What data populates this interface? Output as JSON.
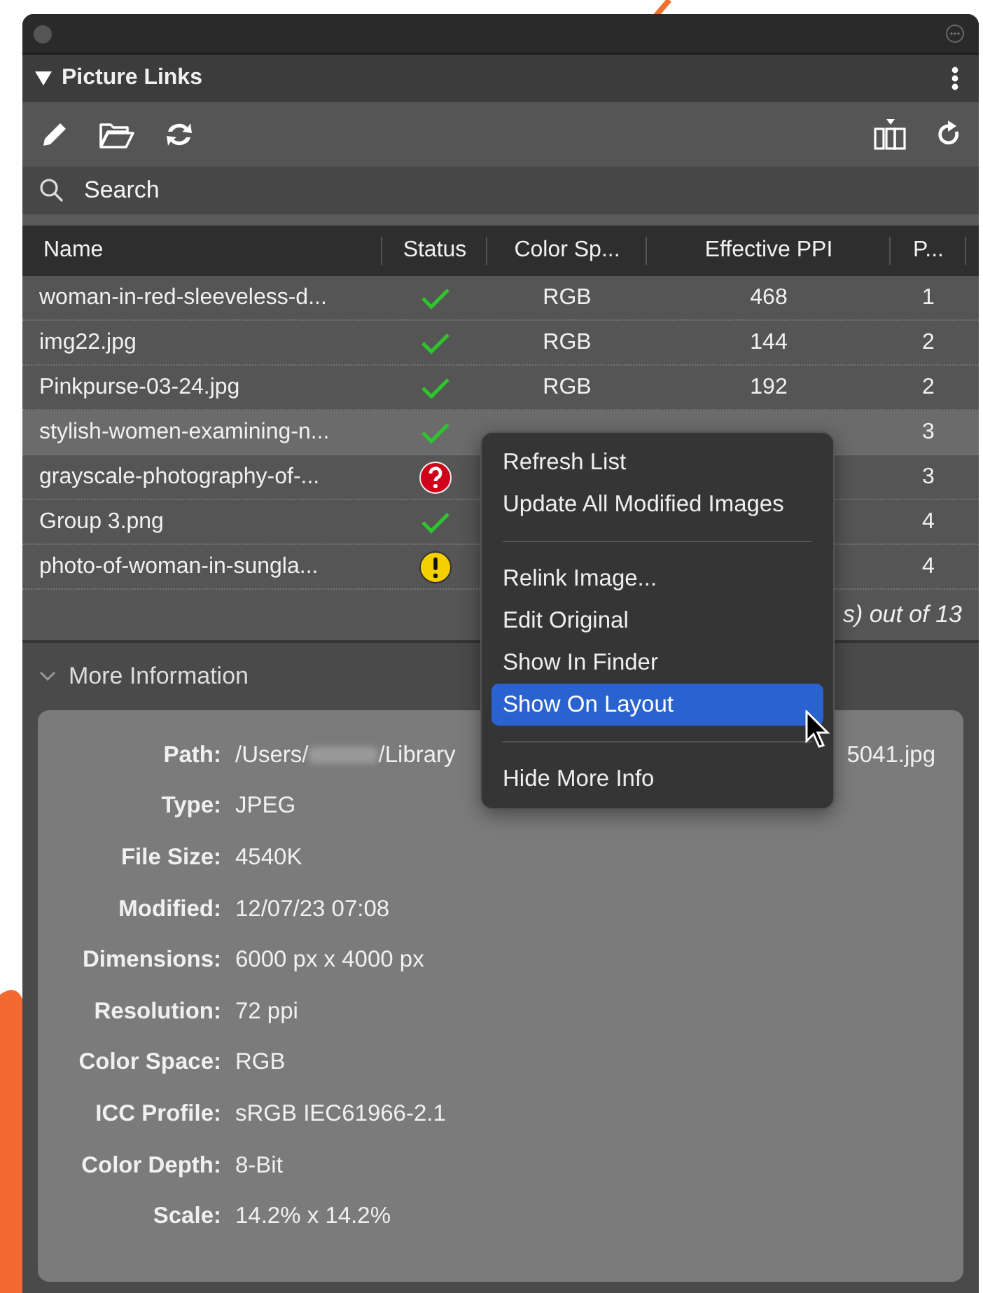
{
  "panel": {
    "title": "Picture Links"
  },
  "search": {
    "placeholder": "Search"
  },
  "table": {
    "columns": [
      "Name",
      "Status",
      "Color Sp...",
      "Effective PPI",
      "P..."
    ],
    "rows": [
      {
        "name": "woman-in-red-sleeveless-d...",
        "kind": "ok",
        "color_space": "RGB",
        "ppi": "468",
        "page": "1",
        "selected": false
      },
      {
        "name": "img22.jpg",
        "kind": "ok",
        "color_space": "RGB",
        "ppi": "144",
        "page": "2",
        "selected": false
      },
      {
        "name": "Pinkpurse-03-24.jpg",
        "kind": "ok",
        "color_space": "RGB",
        "ppi": "192",
        "page": "2",
        "selected": false
      },
      {
        "name": "stylish-women-examining-n...",
        "kind": "ok",
        "page": "3",
        "selected": true
      },
      {
        "name": "grayscale-photography-of-...",
        "kind": "missing",
        "page": "3",
        "selected": false
      },
      {
        "name": "Group 3.png",
        "kind": "ok",
        "page": "4",
        "selected": false
      },
      {
        "name": "photo-of-woman-in-sungla...",
        "kind": "modified",
        "page": "4",
        "selected": false
      }
    ],
    "footer": "s) out of 13"
  },
  "more_information": {
    "title": "More Information",
    "expanded": true,
    "fields": [
      {
        "label": "Path:",
        "value": "/Users/",
        "value_2": "/Library",
        "value_end": "5041.jpg"
      },
      {
        "label": "Type:",
        "value": "JPEG"
      },
      {
        "label": "File Size:",
        "value": "4540K"
      },
      {
        "label": "Modified:",
        "value": "12/07/23  07:08"
      },
      {
        "label": "Dimensions:",
        "value": "6000 px x 4000 px"
      },
      {
        "label": "Resolution:",
        "value": "72 ppi"
      },
      {
        "label": "Color Space:",
        "value": "RGB"
      },
      {
        "label": "ICC Profile:",
        "value": "sRGB IEC61966-2.1"
      },
      {
        "label": "Color Depth:",
        "value": "8-Bit"
      },
      {
        "label": "Scale:",
        "value": "14.2% x 14.2%"
      }
    ]
  },
  "context_menu": [
    {
      "kind": "item",
      "label": "Refresh List",
      "selected": false
    },
    {
      "kind": "item",
      "label": "Update All Modified Images",
      "selected": false
    },
    {
      "kind": "separator"
    },
    {
      "kind": "item",
      "label": "Relink Image...",
      "selected": false
    },
    {
      "kind": "item",
      "label": "Edit Original",
      "selected": false
    },
    {
      "kind": "item",
      "label": "Show In Finder",
      "selected": false
    },
    {
      "kind": "item",
      "label": "Show On Layout",
      "selected": true
    },
    {
      "kind": "separator"
    },
    {
      "kind": "item",
      "label": "Hide More Info",
      "selected": false
    }
  ]
}
